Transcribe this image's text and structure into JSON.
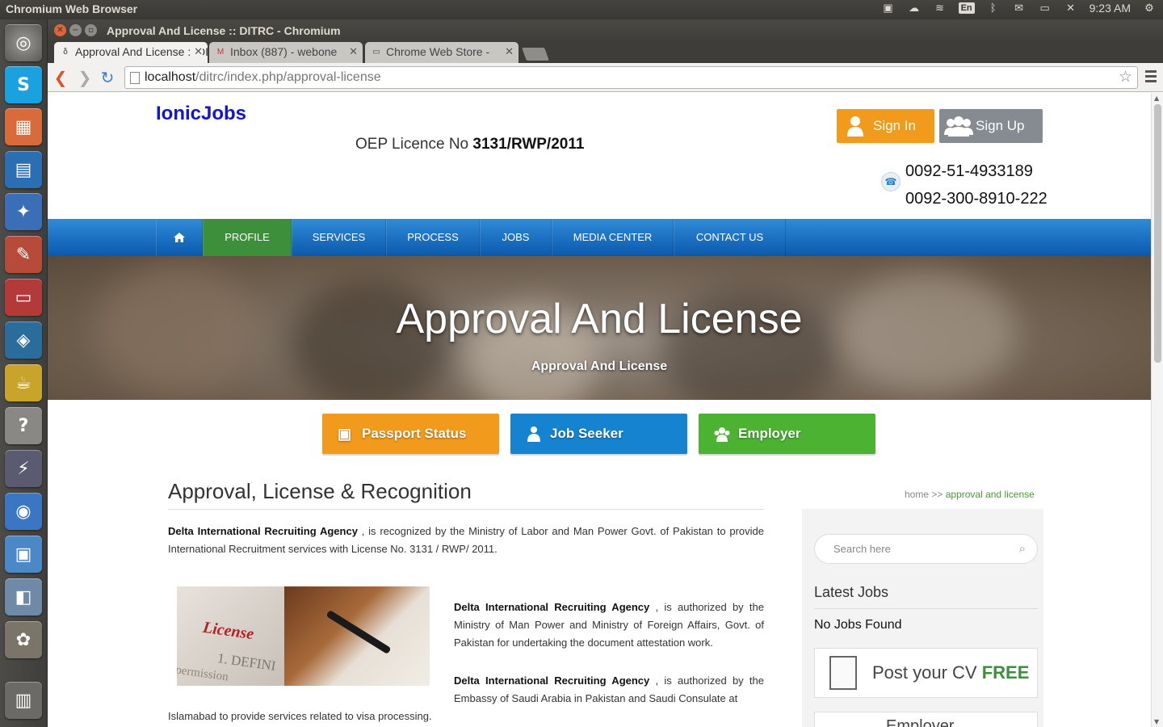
{
  "os": {
    "app_title": "Chromium Web Browser",
    "tray": {
      "lang": "En",
      "time": "9:23 AM"
    }
  },
  "browser": {
    "window_title": "Approval And License :: DITRC - Chromium",
    "tabs": [
      {
        "label": "Approval And License :: DITRC",
        "favicon": "delta-icon",
        "active": true
      },
      {
        "label": "Inbox (887) - webone",
        "favicon": "gmail-icon",
        "active": false
      },
      {
        "label": "Chrome Web Store -",
        "favicon": "store-icon",
        "active": false
      }
    ],
    "url_host": "localhost",
    "url_path": "/ditrc/index.php/approval-license"
  },
  "header": {
    "logo": "IonicJobs",
    "oep_label": "OEP Licence No",
    "oep_number": "3131/RWP/2011",
    "signin": "Sign In",
    "signup": "Sign Up",
    "phone1": "0092-51-4933189",
    "phone2": "0092-300-8910-222"
  },
  "nav": {
    "items": [
      "PROFILE",
      "SERVICES",
      "PROCESS",
      "JOBS",
      "MEDIA CENTER",
      "CONTACT US"
    ],
    "active": "PROFILE"
  },
  "hero": {
    "title": "Approval And License",
    "subtitle": "Approval And License"
  },
  "quick": {
    "passport": "Passport Status",
    "jobseeker": "Job Seeker",
    "employer": "Employer"
  },
  "content": {
    "heading": "Approval, License & Recognition",
    "breadcrumb_home": "home >>",
    "breadcrumb_current": "approval and license",
    "agency": "Delta International Recruiting Agency",
    "p1_rest": " , is recognized by the Ministry of Labor and Man Power Govt. of Pakistan to provide International Recruitment services with License No. 3131 / RWP/ 2011.",
    "p2_rest": " , is authorized by the Ministry of Man Power and Ministry of Foreign Affairs, Govt. of Pakistan for undertaking the document attestation work.",
    "p3_rest": " , is authorized by the Embassy of Saudi Arabia in Pakistan and Saudi Consulate at",
    "p3_tail": "Islamabad to provide services related to visa processing.",
    "image_text": {
      "word": "License",
      "def": "1. DEFINI",
      "perm": "permission"
    }
  },
  "sidebar": {
    "search_placeholder": "Search here",
    "latest_jobs": "Latest Jobs",
    "no_jobs": "No Jobs Found",
    "post_cv": "Post your CV",
    "post_cv_free": "FREE",
    "employer_box": "Employer"
  },
  "colors": {
    "logo": "#1414d0",
    "signin": "#f29a1b",
    "signup": "#858b90",
    "nav_active": "#3e8f3c",
    "passport": "#f29a1b",
    "jobseeker": "#1683d0",
    "employer": "#4bb232"
  }
}
